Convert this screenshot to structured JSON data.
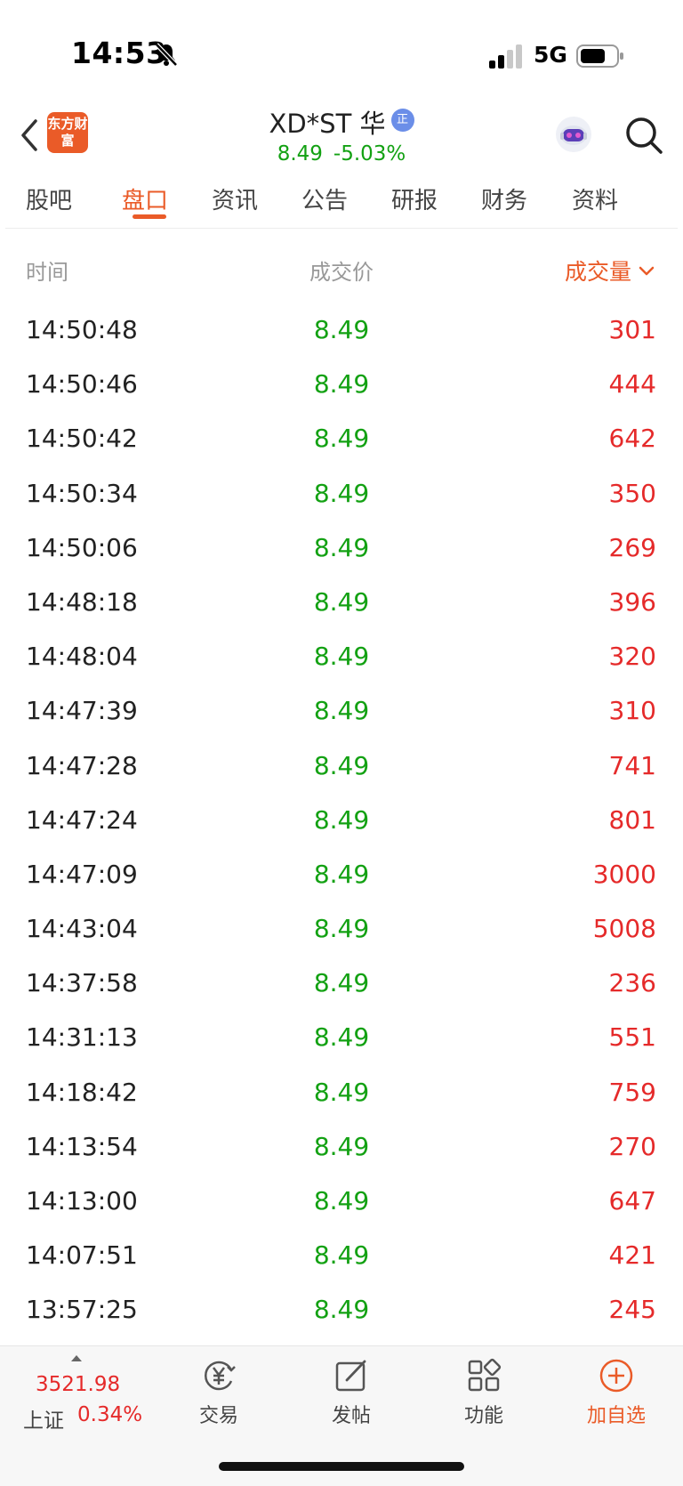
{
  "status_bar": {
    "time": "14:53",
    "network": "5G"
  },
  "header": {
    "logo_text": "东方财富",
    "stock_name": "XD*ST 华",
    "badge": "正",
    "price": "8.49",
    "change_pct": "-5.03%"
  },
  "tabs": [
    {
      "label": "股吧"
    },
    {
      "label": "盘口"
    },
    {
      "label": "资讯"
    },
    {
      "label": "公告"
    },
    {
      "label": "研报"
    },
    {
      "label": "财务"
    },
    {
      "label": "资料"
    }
  ],
  "active_tab": "盘口",
  "columns": {
    "time": "时间",
    "price": "成交价",
    "volume": "成交量"
  },
  "trades": [
    {
      "time": "14:50:48",
      "price": "8.49",
      "volume": "301"
    },
    {
      "time": "14:50:46",
      "price": "8.49",
      "volume": "444"
    },
    {
      "time": "14:50:42",
      "price": "8.49",
      "volume": "642"
    },
    {
      "time": "14:50:34",
      "price": "8.49",
      "volume": "350"
    },
    {
      "time": "14:50:06",
      "price": "8.49",
      "volume": "269"
    },
    {
      "time": "14:48:18",
      "price": "8.49",
      "volume": "396"
    },
    {
      "time": "14:48:04",
      "price": "8.49",
      "volume": "320"
    },
    {
      "time": "14:47:39",
      "price": "8.49",
      "volume": "310"
    },
    {
      "time": "14:47:28",
      "price": "8.49",
      "volume": "741"
    },
    {
      "time": "14:47:24",
      "price": "8.49",
      "volume": "801"
    },
    {
      "time": "14:47:09",
      "price": "8.49",
      "volume": "3000"
    },
    {
      "time": "14:43:04",
      "price": "8.49",
      "volume": "5008"
    },
    {
      "time": "14:37:58",
      "price": "8.49",
      "volume": "236"
    },
    {
      "time": "14:31:13",
      "price": "8.49",
      "volume": "551"
    },
    {
      "time": "14:18:42",
      "price": "8.49",
      "volume": "759"
    },
    {
      "time": "14:13:54",
      "price": "8.49",
      "volume": "270"
    },
    {
      "time": "14:13:00",
      "price": "8.49",
      "volume": "647"
    },
    {
      "time": "14:07:51",
      "price": "8.49",
      "volume": "421"
    },
    {
      "time": "13:57:25",
      "price": "8.49",
      "volume": "245"
    }
  ],
  "bottom_bar": {
    "index_value": "3521.98",
    "index_name": "上证",
    "index_change": "0.34%",
    "nav": [
      {
        "label": "交易",
        "icon": "trade-yen-icon"
      },
      {
        "label": "发帖",
        "icon": "compose-icon"
      },
      {
        "label": "功能",
        "icon": "apps-grid-icon"
      },
      {
        "label": "加自选",
        "icon": "add-circle-icon"
      }
    ]
  },
  "colors": {
    "accent": "#ea5b28",
    "price_down": "#13a113",
    "volume_up": "#e52a2a",
    "badge_blue": "#6b8ee8"
  }
}
